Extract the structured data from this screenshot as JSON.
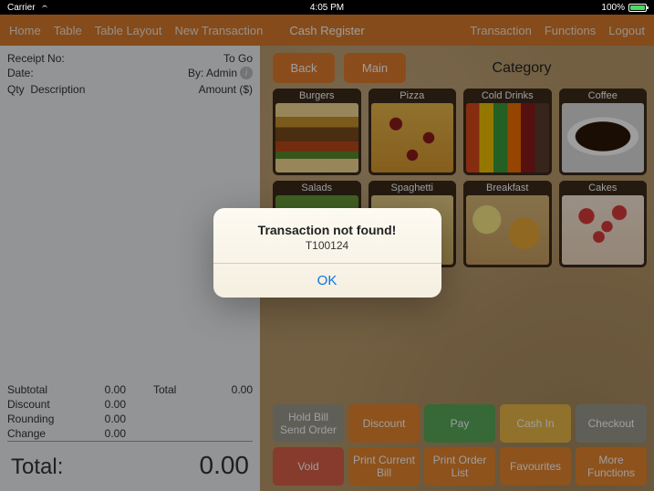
{
  "statusbar": {
    "carrier": "Carrier",
    "wifi": true,
    "time": "4:05 PM",
    "battery_pct": "100%"
  },
  "nav": {
    "left": [
      "Home",
      "Table",
      "Table Layout",
      "New Transaction"
    ],
    "title": "Cash Register",
    "right": [
      "Transaction",
      "Functions",
      "Logout"
    ]
  },
  "receipt": {
    "receipt_no_label": "Receipt No:",
    "receipt_no_value": "To Go",
    "date_label": "Date:",
    "date_by": "By: Admin",
    "header_qty": "Qty",
    "header_desc": "Description",
    "header_amount": "Amount ($)",
    "totals": {
      "subtotal_label": "Subtotal",
      "subtotal": "0.00",
      "discount_label": "Discount",
      "discount": "0.00",
      "rounding_label": "Rounding",
      "rounding": "0.00",
      "change_label": "Change",
      "change": "0.00",
      "total_label": "Total",
      "total": "0.00"
    },
    "grand_label": "Total:",
    "grand_value": "0.00"
  },
  "main": {
    "back": "Back",
    "mainbtn": "Main",
    "category_title": "Category",
    "tiles": [
      "Burgers",
      "Pizza",
      "Cold Drinks",
      "Coffee",
      "Salads",
      "Spaghetti",
      "Breakfast",
      "Cakes"
    ],
    "actions_row1": [
      "Hold Bill Send Order",
      "Discount",
      "Pay",
      "Cash In",
      "Checkout"
    ],
    "actions_row2": [
      "Void",
      "Print Current Bill",
      "Print Order List",
      "Favourites",
      "More Functions"
    ]
  },
  "alert": {
    "title": "Transaction not found!",
    "sub": "T100124",
    "ok": "OK"
  }
}
